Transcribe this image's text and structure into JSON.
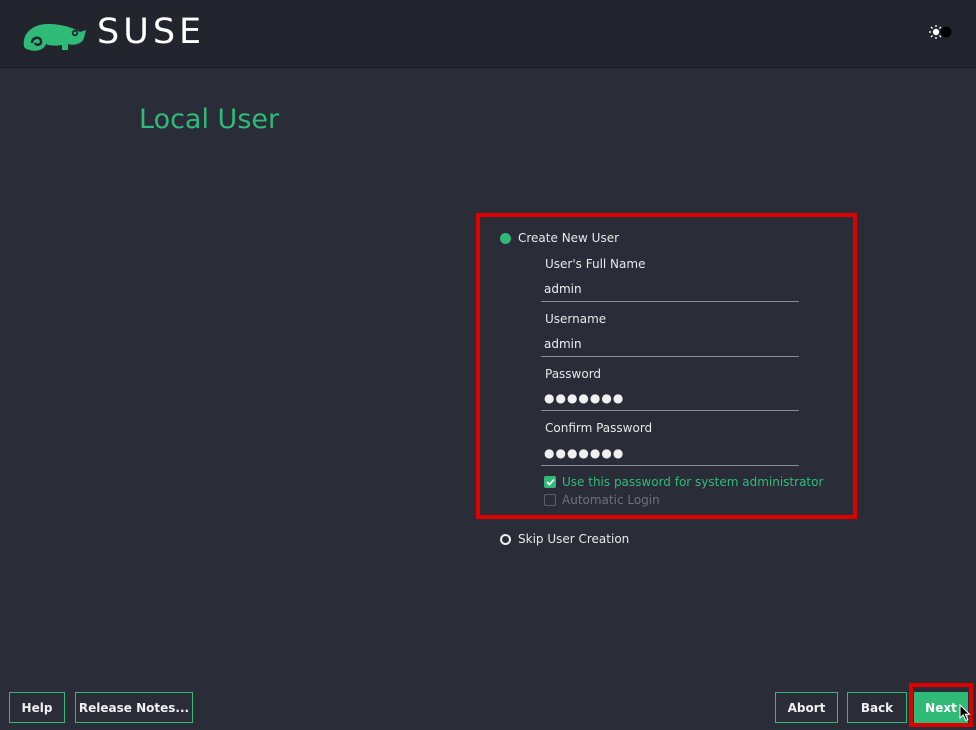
{
  "header": {
    "brand": "SUSE"
  },
  "page": {
    "title": "Local User"
  },
  "form": {
    "create_option_label": "Create New User",
    "full_name_label": "User's Full Name",
    "full_name_value": "admin",
    "username_label": "Username",
    "username_value": "admin",
    "password_label": "Password",
    "password_value": "●●●●●●●",
    "confirm_password_label": "Confirm Password",
    "confirm_password_value": "●●●●●●●",
    "use_for_admin_label": "Use this password for system administrator",
    "auto_login_label": "Automatic Login",
    "skip_option_label": "Skip User Creation"
  },
  "buttons": {
    "help": "Help",
    "release_notes": "Release Notes...",
    "abort": "Abort",
    "back": "Back",
    "next": "Next"
  },
  "colors": {
    "accent": "#30ba78",
    "background": "#2a2d38",
    "header": "#23252e",
    "highlight": "#e00000"
  }
}
